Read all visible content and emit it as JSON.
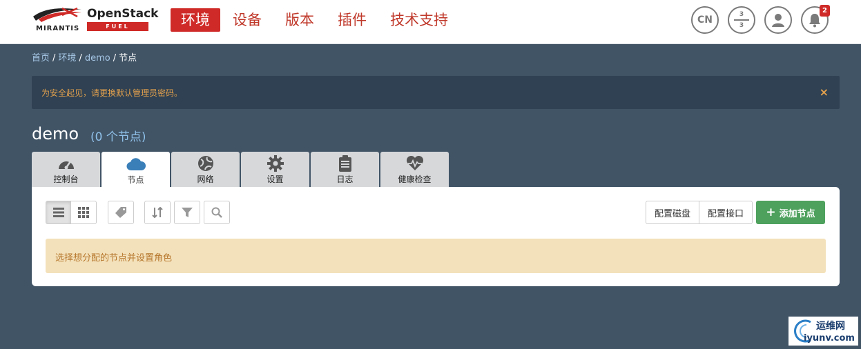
{
  "header": {
    "logo": {
      "brand": "MIRANTIS",
      "product": "OpenStack",
      "sub": "FUEL"
    },
    "nav": [
      {
        "label": "环境",
        "active": true
      },
      {
        "label": "设备",
        "active": false
      },
      {
        "label": "版本",
        "active": false
      },
      {
        "label": "插件",
        "active": false
      },
      {
        "label": "技术支持",
        "active": false
      }
    ],
    "language": "CN",
    "capacity": {
      "top": "3",
      "bottom": "3"
    },
    "notifications_count": "2"
  },
  "breadcrumb": {
    "home": "首页",
    "env": "环境",
    "cluster": "demo",
    "current": "节点",
    "sep": "/"
  },
  "alert": {
    "message": "为安全起见，请更换默认管理员密码。",
    "close": "×"
  },
  "page": {
    "title": "demo",
    "subtitle": "(0 个节点)"
  },
  "tabs": [
    {
      "label": "控制台",
      "icon": "dashboard-icon"
    },
    {
      "label": "节点",
      "icon": "cloud-icon",
      "active": true
    },
    {
      "label": "网络",
      "icon": "globe-icon"
    },
    {
      "label": "设置",
      "icon": "gear-icon"
    },
    {
      "label": "日志",
      "icon": "clipboard-icon"
    },
    {
      "label": "健康检查",
      "icon": "heart-pulse-icon"
    }
  ],
  "toolbar": {
    "configure_disks": "配置磁盘",
    "configure_interfaces": "配置接口",
    "add_nodes": "添加节点"
  },
  "notice": "选择想分配的节点并设置角色",
  "watermark": {
    "cn": "运维网",
    "url": "iyunv.com"
  },
  "colors": {
    "accent": "#cf2a27",
    "background": "#415466",
    "success": "#4ea15d",
    "warning_bg": "#f3e1bb"
  }
}
